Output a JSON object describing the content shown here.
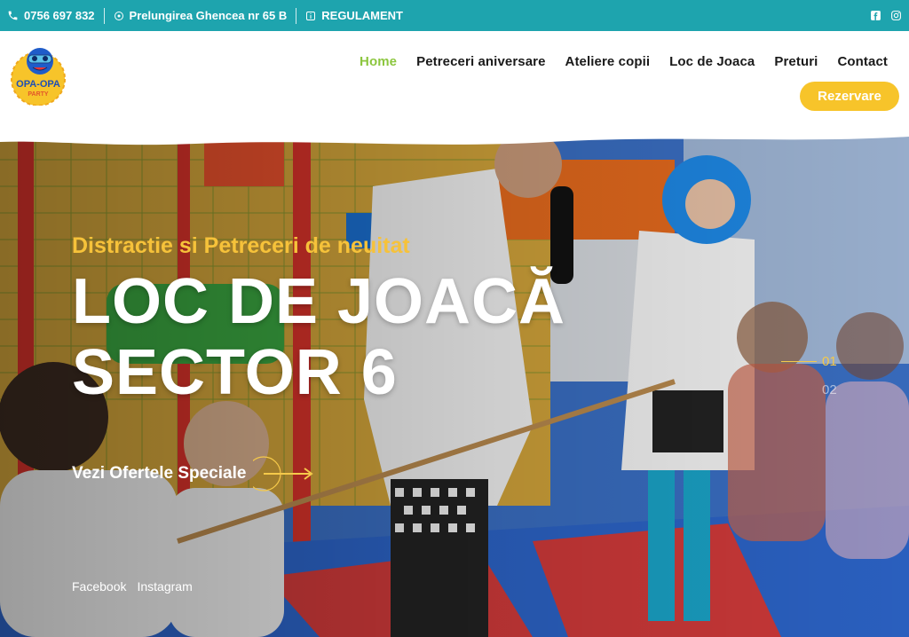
{
  "topbar": {
    "phone": "0756 697 832",
    "address": "Prelungirea Ghencea nr 65 B",
    "rules": "REGULAMENT",
    "icons": [
      "phone-icon",
      "location-icon",
      "info-icon",
      "facebook-icon",
      "instagram-icon"
    ]
  },
  "header": {
    "logo_text": "OPA-OPA",
    "logo_sub": "PARTY",
    "nav": [
      {
        "label": "Home",
        "active": true
      },
      {
        "label": "Petreceri aniversare"
      },
      {
        "label": "Ateliere copii"
      },
      {
        "label": "Loc de Joaca"
      },
      {
        "label": "Preturi"
      },
      {
        "label": "Contact"
      }
    ],
    "cta": "Rezervare"
  },
  "hero": {
    "subtitle": "Distractie si Petreceri de neuitat",
    "title_line1": "LOC DE JOACĂ",
    "title_line2": "SECTOR 6",
    "offers": "Vezi Ofertele Speciale",
    "social_facebook": "Facebook",
    "social_instagram": "Instagram",
    "slides": [
      "01",
      "02"
    ]
  },
  "colors": {
    "topbar": "#1ea4ae",
    "accent_yellow": "#f7c42a",
    "active_nav": "#8cc63f"
  }
}
